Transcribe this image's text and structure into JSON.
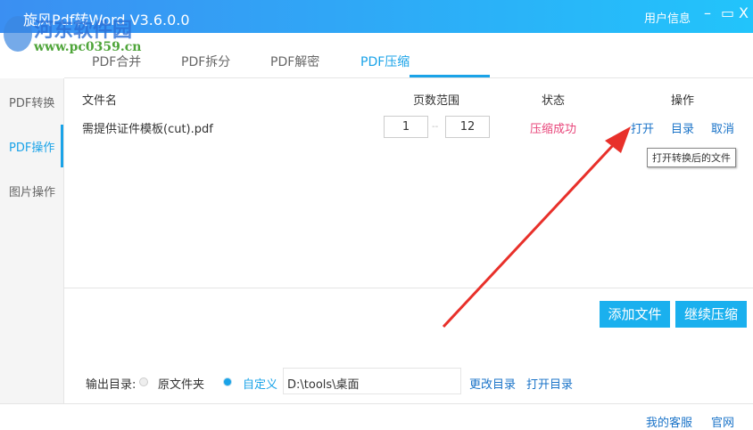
{
  "window": {
    "title": "旋风Pdf转Word V3.6.0.0",
    "user_info": "用户信息",
    "minimize": "–",
    "maximize": "▭",
    "close": "X"
  },
  "watermark": {
    "name": "河东软件园",
    "url": "www.pc0359.cn"
  },
  "tabs": [
    "PDF合并",
    "PDF拆分",
    "PDF解密",
    "PDF压缩"
  ],
  "sidebar": [
    "PDF转换",
    "PDF操作",
    "图片操作"
  ],
  "table": {
    "headers": {
      "name": "文件名",
      "range": "页数范围",
      "status": "状态",
      "action": "操作"
    },
    "rows": [
      {
        "name": "需提供证件模板(cut).pdf",
        "from": "1",
        "sep": "--",
        "to": "12",
        "status": "压缩成功",
        "open": "打开",
        "dir": "目录",
        "cancel": "取消"
      }
    ]
  },
  "tooltip": "打开转换后的文件",
  "buttons": {
    "add": "添加文件",
    "continue": "继续压缩"
  },
  "output": {
    "label": "输出目录:",
    "original": "原文件夹",
    "custom": "自定义",
    "path": "D:\\tools\\桌面",
    "change": "更改目录",
    "open": "打开目录"
  },
  "footer": {
    "service": "我的客服",
    "site": "官网"
  },
  "colors": {
    "accent": "#1aa3e8",
    "success": "#e8457a",
    "arrow": "#e8302a"
  }
}
